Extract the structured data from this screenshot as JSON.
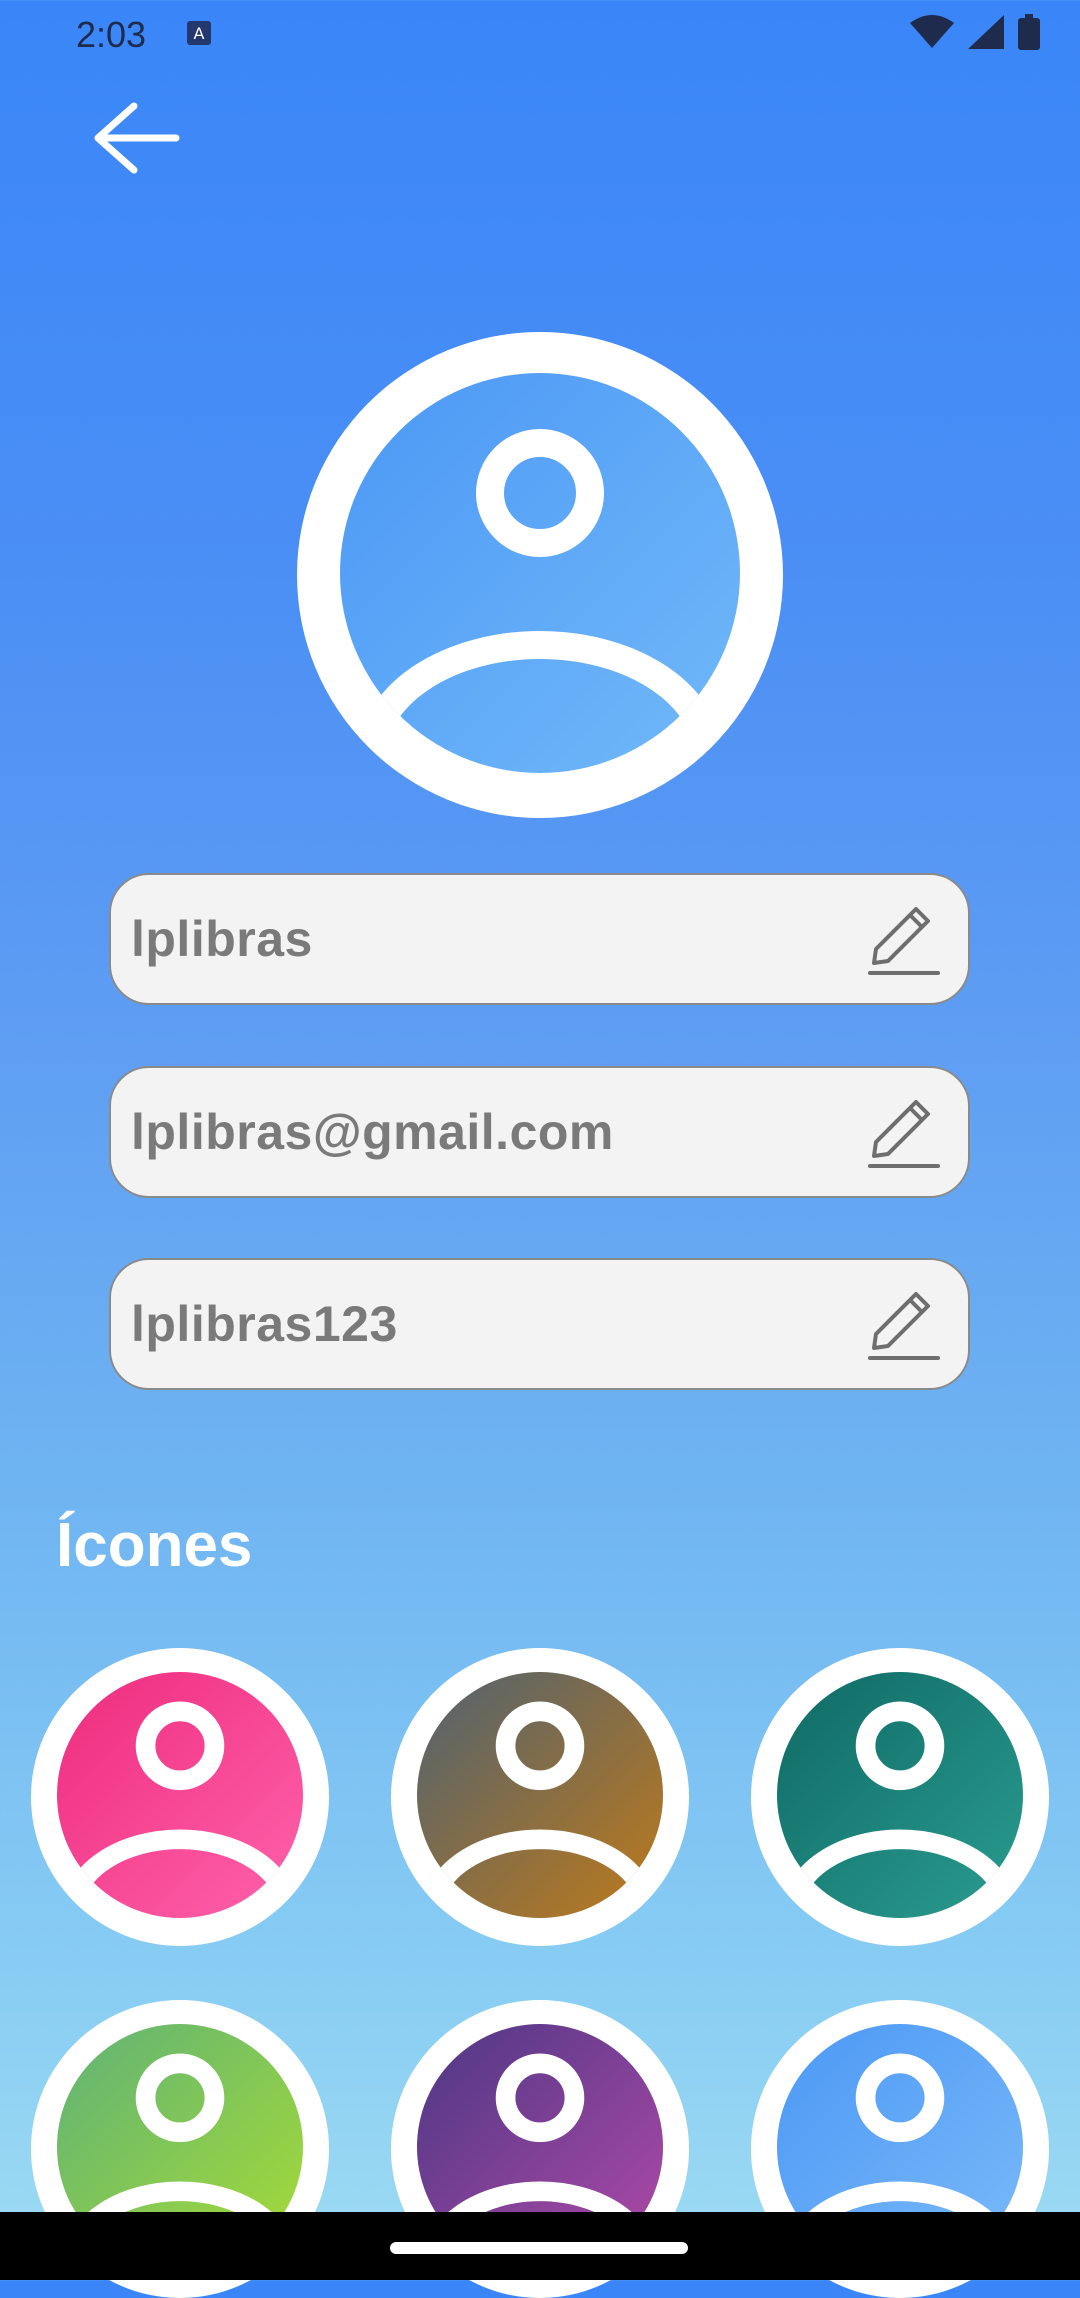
{
  "status_bar": {
    "time": "2:03"
  },
  "profile": {
    "username": "lplibras",
    "email": "lplibras@gmail.com",
    "password": "lplibras123"
  },
  "icons_section": {
    "title": "Ícones",
    "options": [
      {
        "name": "pink",
        "colors": [
          "#ee2c7e",
          "#ff62ab"
        ]
      },
      {
        "name": "olive-orange",
        "colors": [
          "#4f6271",
          "#bf7a1a"
        ]
      },
      {
        "name": "teal",
        "colors": [
          "#0f6a64",
          "#2a9c90"
        ]
      },
      {
        "name": "green",
        "colors": [
          "#5eb277",
          "#a8dc35"
        ]
      },
      {
        "name": "purple",
        "colors": [
          "#4b3784",
          "#b24aa8"
        ]
      },
      {
        "name": "blue",
        "colors": [
          "#4b98f6",
          "#7bbaf8"
        ]
      }
    ]
  },
  "colors": {
    "main_avatar": [
      "#4b98f6",
      "#72b9f8"
    ]
  }
}
